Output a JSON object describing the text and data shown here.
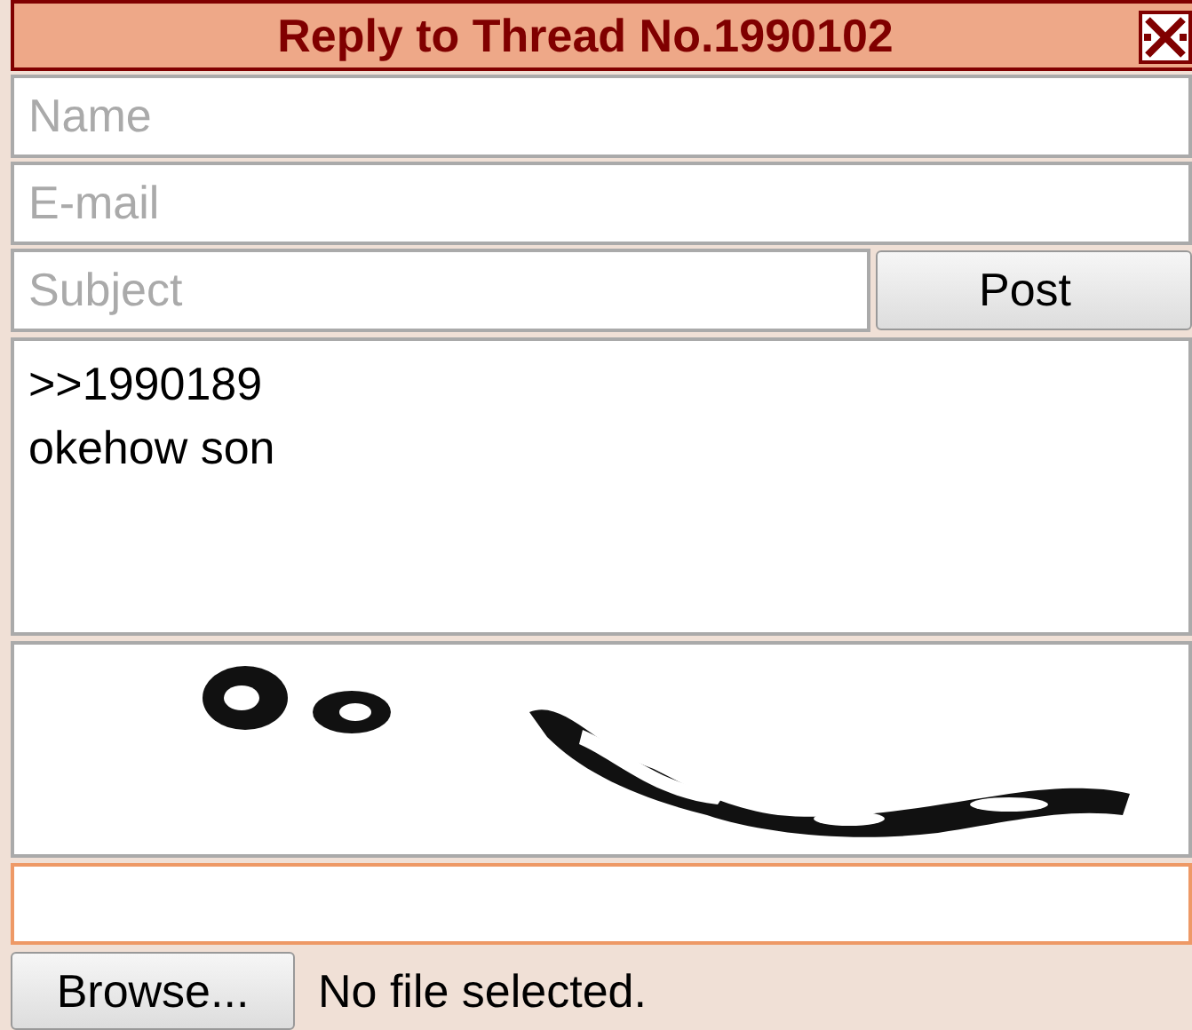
{
  "dialog": {
    "title": "Reply to Thread No.1990102"
  },
  "fields": [
    {
      "placeholder": "Name"
    },
    {
      "placeholder": "E-mail"
    }
  ],
  "subject": {
    "placeholder": "Subject"
  },
  "post_button": "Post",
  "comment": {
    "value": ">>1990189\nokehow son"
  },
  "captcha_response": {
    "focused": true
  },
  "file": {
    "button": "Browse...",
    "status": "No file selected."
  }
}
